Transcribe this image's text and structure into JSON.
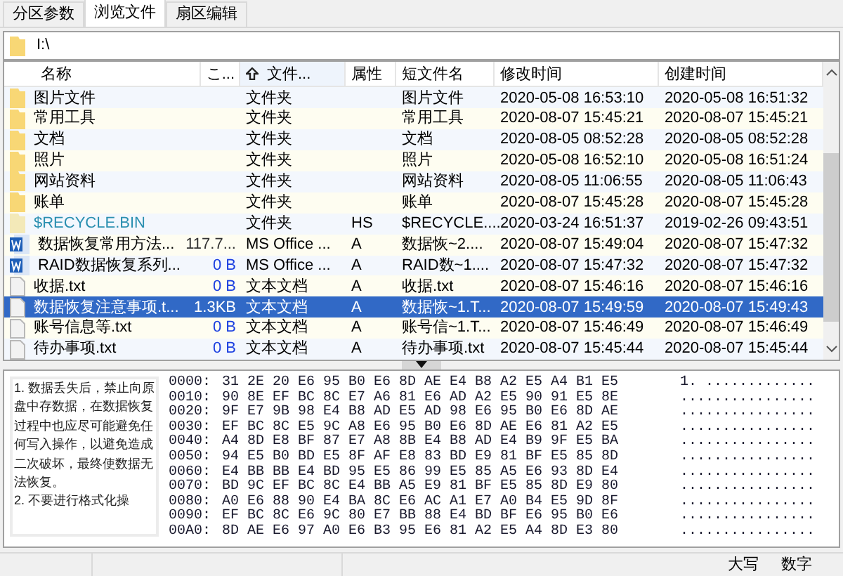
{
  "tabs": [
    {
      "label": "分区参数",
      "selected": false
    },
    {
      "label": "浏览文件",
      "selected": true
    },
    {
      "label": "扇区编辑",
      "selected": false
    }
  ],
  "path": {
    "value": "I:\\"
  },
  "table": {
    "columns": [
      {
        "label": "名称",
        "sorted": false
      },
      {
        "label": "こ...",
        "sorted": false
      },
      {
        "label": "文件...",
        "sorted": true
      },
      {
        "label": "属性",
        "sorted": false
      },
      {
        "label": "短文件名",
        "sorted": false
      },
      {
        "label": "修改时间",
        "sorted": false
      },
      {
        "label": "创建时间",
        "sorted": false
      }
    ],
    "rows": [
      {
        "kind": "folder",
        "name": "图片文件",
        "type": "文件夹",
        "short": "图片文件",
        "modified": "2020-05-08 16:53:10",
        "created": "2020-05-08 16:51:32",
        "selected": false
      },
      {
        "kind": "folder",
        "name": "常用工具",
        "type": "文件夹",
        "short": "常用工具",
        "modified": "2020-08-07 15:45:21",
        "created": "2020-08-07 15:45:21",
        "selected": false
      },
      {
        "kind": "folder",
        "name": "文档",
        "type": "文件夹",
        "short": "文档",
        "modified": "2020-08-05 08:52:28",
        "created": "2020-08-05 08:52:28",
        "selected": false
      },
      {
        "kind": "folder",
        "name": "照片",
        "type": "文件夹",
        "short": "照片",
        "modified": "2020-05-08 16:52:10",
        "created": "2020-05-08 16:51:24",
        "selected": false
      },
      {
        "kind": "folder",
        "name": "网站资料",
        "type": "文件夹",
        "short": "网站资料",
        "modified": "2020-08-05 11:06:55",
        "created": "2020-08-05 11:06:43",
        "selected": false
      },
      {
        "kind": "folder",
        "name": "账单",
        "type": "文件夹",
        "short": "账单",
        "modified": "2020-08-07 15:45:28",
        "created": "2020-08-07 15:45:28",
        "selected": false
      },
      {
        "kind": "system",
        "name": "$RECYCLE.BIN",
        "type": "文件夹",
        "attr": "HS",
        "short": "$RECYCLE....",
        "modified": "2020-03-24 16:51:37",
        "created": "2019-02-26 09:43:51",
        "selected": false
      },
      {
        "kind": "word",
        "name": "数据恢复常用方法...",
        "size": "117.7...",
        "type": "MS Office ...",
        "attr": "A",
        "short": "数据恢~2....",
        "modified": "2020-08-07 15:49:04",
        "created": "2020-08-07 15:47:32",
        "selected": false,
        "color": "#333333"
      },
      {
        "kind": "word",
        "name": "RAID数据恢复系列...",
        "size": "0 B",
        "type": "MS Office ...",
        "attr": "A",
        "short": "RAID数~1....",
        "modified": "2020-08-07 15:47:32",
        "created": "2020-08-07 15:47:32",
        "selected": false,
        "color": "#1b3fe0"
      },
      {
        "kind": "text",
        "name": "收据.txt",
        "size": "0 B",
        "type": "文本文档",
        "attr": "A",
        "short": "收据.txt",
        "modified": "2020-08-07 15:46:16",
        "created": "2020-08-07 15:46:16",
        "selected": false,
        "color": "#1b3fe0"
      },
      {
        "kind": "text",
        "name": "数据恢复注意事项.t...",
        "size": "1.3KB",
        "type": "文本文档",
        "attr": "A",
        "short": "数据恢~1.T...",
        "modified": "2020-08-07 15:49:59",
        "created": "2020-08-07 15:49:43",
        "selected": true
      },
      {
        "kind": "text",
        "name": "账号信息等.txt",
        "size": "0 B",
        "type": "文本文档",
        "attr": "A",
        "short": "账号信~1.T...",
        "modified": "2020-08-07 15:46:49",
        "created": "2020-08-07 15:46:49",
        "selected": false,
        "color": "#1b3fe0"
      },
      {
        "kind": "text",
        "name": "待办事项.txt",
        "size": "0 B",
        "type": "文本文档",
        "attr": "A",
        "short": "待办事项.txt",
        "modified": "2020-08-07 15:45:44",
        "created": "2020-08-07 15:45:44",
        "selected": false,
        "color": "#1b3fe0"
      }
    ]
  },
  "preview": {
    "paragraphs": [
      "1. 数据丢失后，禁止向原盘中存数据，在数据恢复过程中也应尽可能避免任何写入操作，以避免造成二次破坏，最终使数据无法恢复。",
      "2. 不要进行格式化操"
    ]
  },
  "hex": [
    {
      "offset": "0000:",
      "bytes": "31 2E 20 E6 95 B0 E6 8D AE E4 B8 A2 E5 A4 B1 E5",
      "ascii": "1. ............."
    },
    {
      "offset": "0010:",
      "bytes": "90 8E EF BC 8C E7 A6 81 E6 AD A2 E5 90 91 E5 8E",
      "ascii": "................"
    },
    {
      "offset": "0020:",
      "bytes": "9F E7 9B 98 E4 B8 AD E5 AD 98 E6 95 B0 E6 8D AE",
      "ascii": "................"
    },
    {
      "offset": "0030:",
      "bytes": "EF BC 8C E5 9C A8 E6 95 B0 E6 8D AE E6 81 A2 E5",
      "ascii": "................"
    },
    {
      "offset": "0040:",
      "bytes": "A4 8D E8 BF 87 E7 A8 8B E4 B8 AD E4 B9 9F E5 BA",
      "ascii": "................"
    },
    {
      "offset": "0050:",
      "bytes": "94 E5 B0 BD E5 8F AF E8 83 BD E9 81 BF E5 85 8D",
      "ascii": "................"
    },
    {
      "offset": "0060:",
      "bytes": "E4 BB BB E4 BD 95 E5 86 99 E5 85 A5 E6 93 8D E4",
      "ascii": "................"
    },
    {
      "offset": "0070:",
      "bytes": "BD 9C EF BC 8C E4 BB A5 E9 81 BF E5 85 8D E9 80",
      "ascii": "................"
    },
    {
      "offset": "0080:",
      "bytes": "A0 E6 88 90 E4 BA 8C E6 AC A1 E7 A0 B4 E5 9D 8F",
      "ascii": "................"
    },
    {
      "offset": "0090:",
      "bytes": "EF BC 8C E6 9C 80 E7 BB 88 E4 BD BF E6 95 B0 E6",
      "ascii": "................"
    },
    {
      "offset": "00A0:",
      "bytes": "8D AE E6 97 A0 E6 B3 95 E6 81 A2 E5 A4 8D E3 80",
      "ascii": "................"
    }
  ],
  "status_bar": [
    "大写",
    "数字"
  ]
}
